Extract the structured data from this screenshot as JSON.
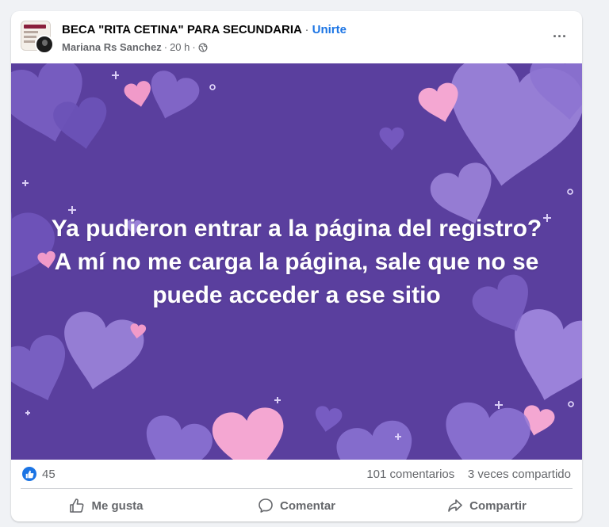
{
  "post": {
    "group_name": "BECA \"RITA CETINA\" PARA SECUNDARIA",
    "separator": "·",
    "join_label": "Unirte",
    "author": "Mariana Rs Sanchez",
    "time": "20 h",
    "visibility_icon": "globe-icon",
    "more_icon": "more-options-icon",
    "more_label": "···",
    "text_line1": "Ya pudieron entrar a la página del registro?",
    "text_line2": "A mí no me carga la página, sale que no se",
    "text_line3": "puede acceder a ese sitio",
    "background_color": "#5a3f9e"
  },
  "stats": {
    "reaction_icon": "like-icon",
    "reactions": "45",
    "comments": "101 comentarios",
    "shares": "3 veces compartido"
  },
  "actions": {
    "like": "Me gusta",
    "comment": "Comentar",
    "share": "Compartir"
  },
  "colors": {
    "accent": "#1b74e4",
    "secondary_text": "#65676b"
  }
}
